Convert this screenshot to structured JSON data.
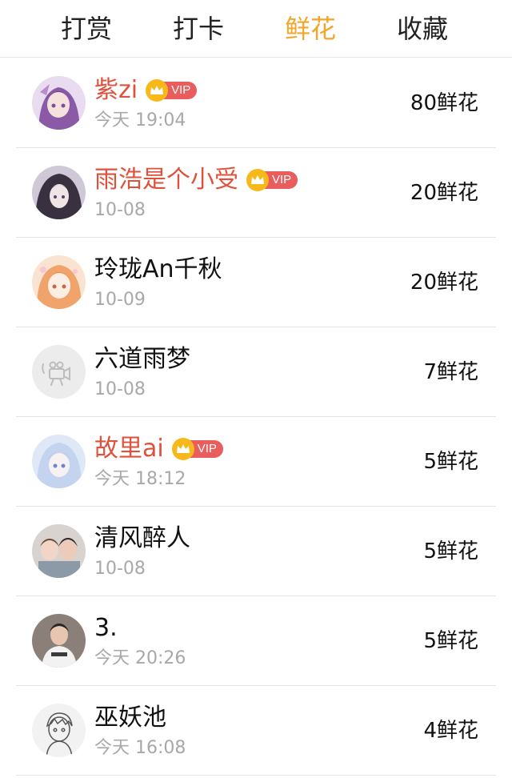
{
  "tabs": [
    {
      "label": "打赏",
      "active": false
    },
    {
      "label": "打卡",
      "active": false
    },
    {
      "label": "鲜花",
      "active": true
    },
    {
      "label": "收藏",
      "active": false
    }
  ],
  "colors": {
    "active_tab": "#f4a62a",
    "vip_name": "#e0513c",
    "vip_badge": "#ea5d5d",
    "crown": "#f7b819",
    "time": "#a8a8a8"
  },
  "vip_label": "VIP",
  "rows": [
    {
      "name": "紫zi",
      "vip": true,
      "time": "今天 19:04",
      "flowers": "80鲜花",
      "avatar": "avatar-anime-purple-icon"
    },
    {
      "name": "雨浩是个小受",
      "vip": true,
      "time": "10-08",
      "flowers": "20鲜花",
      "avatar": "avatar-anime-dark-icon"
    },
    {
      "name": "玲珑An千秋",
      "vip": false,
      "time": "10-09",
      "flowers": "20鲜花",
      "avatar": "avatar-anime-orange-icon"
    },
    {
      "name": "六道雨梦",
      "vip": false,
      "time": "10-08",
      "flowers": "7鲜花",
      "avatar": "avatar-default-camera-icon"
    },
    {
      "name": "故里ai",
      "vip": true,
      "time": "今天 18:12",
      "flowers": "5鲜花",
      "avatar": "avatar-anime-blue-icon"
    },
    {
      "name": "清风醉人",
      "vip": false,
      "time": "10-08",
      "flowers": "5鲜花",
      "avatar": "avatar-photo-couple-icon"
    },
    {
      "name": "3.",
      "vip": false,
      "time": "今天 20:26",
      "flowers": "5鲜花",
      "avatar": "avatar-photo-person-icon"
    },
    {
      "name": "巫妖池",
      "vip": false,
      "time": "今天 16:08",
      "flowers": "4鲜花",
      "avatar": "avatar-sketch-boy-icon"
    }
  ]
}
